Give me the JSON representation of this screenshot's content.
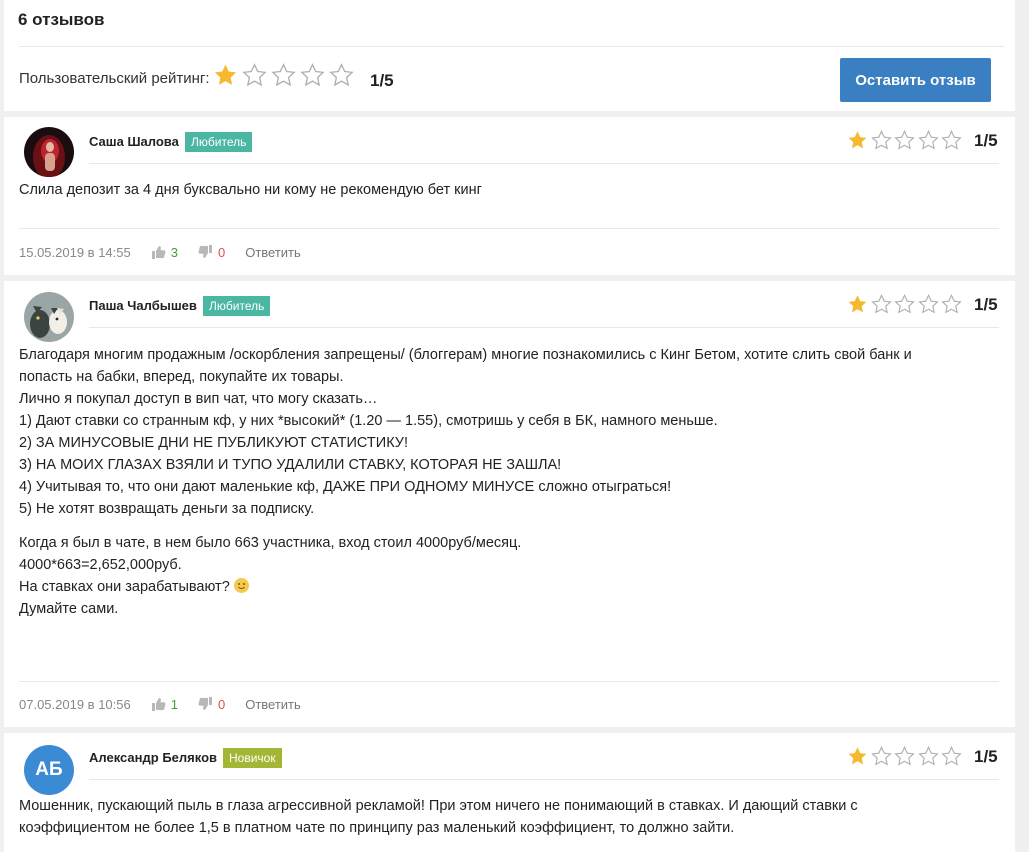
{
  "header": {
    "reviews_count": "6 отзывов",
    "rating_label": "Пользовательский рейтинг:",
    "rating_value": "1/5",
    "rating_stars": 1,
    "leave_review_button": "Оставить отзыв"
  },
  "colors": {
    "star_filled": "#f5b82e",
    "star_empty": "#b0b0b0",
    "button": "#3a7fc1",
    "badge_lover": "#4bb7a3",
    "badge_novice": "#a5b534"
  },
  "reviews": [
    {
      "author": "Саша Шалова",
      "badge": "Любитель",
      "rating_value": "1/5",
      "rating_stars": 1,
      "text": [
        "Слила депозит за 4 дня буксвально ни кому не рекомендую бет кинг"
      ],
      "date": "15.05.2019 в 14:55",
      "likes": "3",
      "dislikes": "0",
      "reply": "Ответить"
    },
    {
      "author": "Паша Чалбышев",
      "badge": "Любитель",
      "rating_value": "1/5",
      "rating_stars": 1,
      "text": [
        "Благодаря многим продажным /оскорбления запрещены/ (блоггерам) многие познакомились с Кинг Бетом, хотите слить свой банк и",
        "попасть на бабки, вперед, покупайте их товары.",
        "Лично я покупал доступ в вип чат, что могу сказать…",
        "1) Дают ставки со странным кф, у них *высокий* (1.20 — 1.55), смотришь у себя в БК, намного меньше.",
        "2) ЗА МИНУСОВЫЕ ДНИ НЕ ПУБЛИКУЮТ СТАТИСТИКУ!",
        "3) НА МОИХ ГЛАЗАХ ВЗЯЛИ И ТУПО УДАЛИЛИ СТАВКУ, КОТОРАЯ НЕ ЗАШЛА!",
        "4) Учитывая то, что они дают маленькие кф, ДАЖЕ ПРИ ОДНОМУ МИНУСЕ сложно отыграться!",
        "5) Не хотят возвращать деньги за подписку.",
        "Когда я был в чате, в нем было 663 участника, вход стоил 4000руб/месяц.",
        "4000*663=2,652,000руб.",
        "На ставках они зарабатывают?",
        "Думайте сами."
      ],
      "date": "07.05.2019 в 10:56",
      "likes": "1",
      "dislikes": "0",
      "reply": "Ответить"
    },
    {
      "author": "Александр Беляков",
      "badge": "Новичок",
      "avatar_initials": "АБ",
      "rating_value": "1/5",
      "rating_stars": 1,
      "text": [
        "Мошенник, пускающий пыль в глаза агрессивной рекламой! При этом ничего не понимающий в ставках. И дающий ставки с",
        "коэффициентом не более 1,5 в платном чате по принципу раз маленький коэффициент, то должно зайти."
      ]
    }
  ]
}
